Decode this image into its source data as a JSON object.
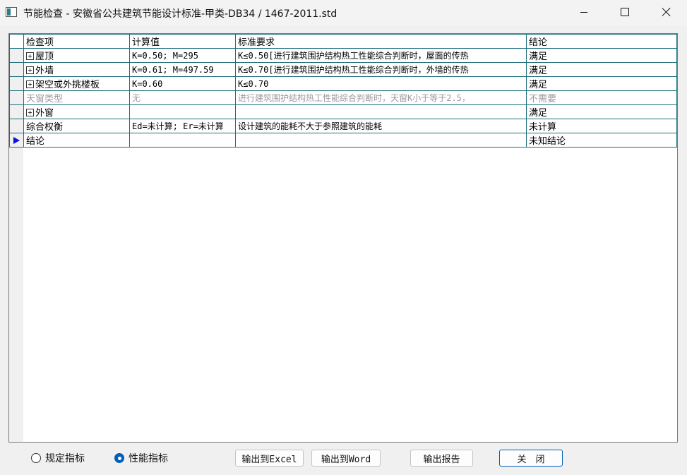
{
  "window": {
    "title": "节能检查 - 安徽省公共建筑节能设计标准-甲类-DB34 / 1467-2011.std"
  },
  "grid": {
    "columns": [
      "检查项",
      "计算值",
      "标准要求",
      "结论"
    ],
    "rows": [
      {
        "item": "屋顶",
        "value": "K=0.50; M=295",
        "requirement": "K≤0.50[进行建筑围护结构热工性能综合判断时，屋面的传热",
        "conclusion": "满足",
        "expandable": true,
        "disabled": false
      },
      {
        "item": "外墙",
        "value": "K=0.61; M=497.59",
        "requirement": "K≤0.70[进行建筑围护结构热工性能综合判断时，外墙的传热",
        "conclusion": "满足",
        "expandable": true,
        "disabled": false
      },
      {
        "item": "架空或外挑楼板",
        "value": "K=0.60",
        "requirement": "K≤0.70",
        "conclusion": "满足",
        "expandable": true,
        "disabled": false
      },
      {
        "item": "天窗类型",
        "value": "无",
        "requirement": "进行建筑围护结构热工性能综合判断时，天窗K小于等于2.5，",
        "conclusion": "不需要",
        "expandable": false,
        "disabled": true
      },
      {
        "item": "外窗",
        "value": "",
        "requirement": "",
        "conclusion": "满足",
        "expandable": true,
        "disabled": false
      },
      {
        "item": "综合权衡",
        "value": "Ed=未计算; Er=未计算",
        "requirement": "设计建筑的能耗不大于参照建筑的能耗",
        "conclusion": "未计算",
        "expandable": false,
        "disabled": false
      },
      {
        "item": "结论",
        "value": "",
        "requirement": "",
        "conclusion": "未知结论",
        "expandable": false,
        "disabled": false,
        "current": true
      }
    ]
  },
  "options": {
    "rule_label": "规定指标",
    "performance_label": "性能指标",
    "selected": "performance"
  },
  "buttons": {
    "export_excel": "输出到Excel",
    "export_word": "输出到Word",
    "export_report": "输出报告",
    "close": "关　闭"
  },
  "colors": {
    "grid_line": "#1d6e7a",
    "current_row_marker": "#1010e0",
    "disabled_text": "#9a9a9a",
    "accent": "#005fb8"
  }
}
